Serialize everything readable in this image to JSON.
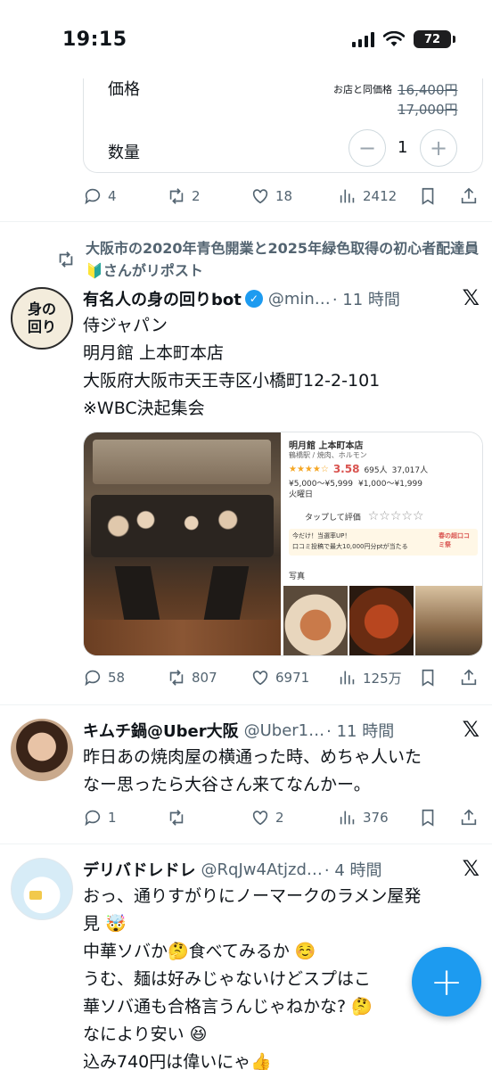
{
  "status_bar": {
    "time": "19:15",
    "battery": "72"
  },
  "product_card": {
    "price_label": "価格",
    "qty_label": "数量",
    "same_price": "お店と同価格",
    "old_price_1": "16,400円",
    "old_price_2": "17,000円",
    "minus": "−",
    "plus": "+",
    "quantity": "1"
  },
  "tweets": [
    {
      "actions": {
        "replies": "4",
        "reposts": "2",
        "likes": "18",
        "views": "2412"
      }
    },
    {
      "repost_by": "大阪市の2020年青色開業と2025年緑色取得の初心者配達員🔰さんがリポスト",
      "name": "有名人の身の回りbot",
      "handle": "@min…",
      "time": "· 11 時間",
      "avatar_text": "身の回り",
      "lines": [
        "侍ジャパン",
        "明月館 上本町本店",
        "大阪府大阪市天王寺区小橋町12-2-101",
        "※WBC決起集会"
      ],
      "media_right": {
        "shop": "明月館 上本町本店",
        "sub": "鶴橋駅 / 焼肉、ホルモン",
        "rating": "3.58",
        "reviews": "695人",
        "saves": "37,017人",
        "price_night": "¥5,000～¥5,999",
        "price_day": "¥1,000～¥1,999",
        "closed": "火曜日",
        "tap_rate": "タップして評価",
        "campaign": "今だけ！当選率UP！",
        "campaign_sub": "口コミ投稿で最大10,000円分ptが当たる",
        "campaign_badge": "春の超口コミ祭",
        "photo_label": "写真"
      },
      "actions": {
        "replies": "58",
        "reposts": "807",
        "likes": "6971",
        "views": "125万"
      }
    },
    {
      "name": "キムチ鍋@Uber大阪",
      "handle": "@Uber1…",
      "time": "· 11 時間",
      "lines": [
        "昨日あの焼肉屋の横通った時、めちゃ人いた",
        "なー思ったら大谷さん来てなんかー。"
      ],
      "actions": {
        "replies": "1",
        "reposts": "",
        "likes": "2",
        "views": "376"
      }
    },
    {
      "name": "デリバドレドレ",
      "handle": "@RqJw4Atjzd…",
      "time": "· 4 時間",
      "lines": [
        "おっ、通りすがりにノーマークのラメン屋発",
        "見 🤯",
        "中華ソバか🤔食べてみるか ☺️",
        "うむ、麺は好みじゃないけどスプはこ",
        "華ソバ通も合格言うんじゃねかな? 🤔",
        "なにより安い 😆",
        "込み740円は偉いにゃ👍"
      ]
    }
  ],
  "fab_label": "+",
  "x_logo": "𝕏"
}
